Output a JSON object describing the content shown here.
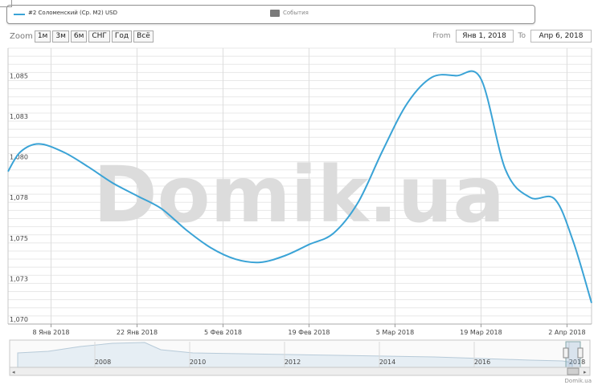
{
  "legend": {
    "series_label": "#2 Соломенский (Ср. М2) USD",
    "events_label": "События"
  },
  "toolbar": {
    "zoom_label": "Zoom",
    "buttons": [
      "1м",
      "3м",
      "6м",
      "СНГ",
      "Год",
      "Всё"
    ],
    "from_label": "From",
    "from_value": "Янв 1, 2018",
    "to_label": "To",
    "to_value": "Апр 6, 2018"
  },
  "watermark": "Domik.ua",
  "credit": "Domik.ua",
  "colors": {
    "series": "#3aa3d6",
    "grid": "#e8e8e8",
    "events": "#7a7a7a"
  },
  "chart_data": {
    "type": "line",
    "x_axis_type": "date",
    "xlim": [
      "2018-01-01",
      "2018-04-06"
    ],
    "ylim": [
      1.07,
      1.087
    ],
    "y_ticks": [
      1.07,
      1.0725,
      1.075,
      1.0775,
      1.08,
      1.0825,
      1.085
    ],
    "y_tick_labels": [
      "1,070",
      "1,073",
      "1,075",
      "1,078",
      "1,080",
      "1,083",
      "1,085"
    ],
    "x_ticks": [
      "2018-01-08",
      "2018-01-22",
      "2018-02-05",
      "2018-02-19",
      "2018-03-05",
      "2018-03-19",
      "2018-04-02"
    ],
    "x_tick_labels": [
      "8 Янв 2018",
      "22 Янв 2018",
      "5 Фев 2018",
      "19 Фев 2018",
      "5 Мар 2018",
      "19 Мар 2018",
      "2 Апр 2018"
    ],
    "grid": true,
    "legend_position": "top",
    "series": [
      {
        "name": "#2 Соломенский (Ср. М2) USD",
        "x": [
          "2018-01-01",
          "2018-01-03",
          "2018-01-06",
          "2018-01-10",
          "2018-01-14",
          "2018-01-18",
          "2018-01-22",
          "2018-01-26",
          "2018-01-30",
          "2018-02-03",
          "2018-02-07",
          "2018-02-11",
          "2018-02-15",
          "2018-02-19",
          "2018-02-23",
          "2018-02-27",
          "2018-03-03",
          "2018-03-07",
          "2018-03-11",
          "2018-03-15",
          "2018-03-19",
          "2018-03-23",
          "2018-03-27",
          "2018-03-31",
          "2018-04-03",
          "2018-04-06"
        ],
        "y": [
          1.0794,
          1.0806,
          1.0811,
          1.0806,
          1.0797,
          1.0787,
          1.0779,
          1.0771,
          1.0758,
          1.0747,
          1.074,
          1.0738,
          1.0742,
          1.0749,
          1.0756,
          1.0775,
          1.0807,
          1.0836,
          1.0852,
          1.0853,
          1.0851,
          1.0795,
          1.0778,
          1.0777,
          1.0751,
          1.0713
        ]
      }
    ],
    "navigator": {
      "year_labels": [
        "2008",
        "2010",
        "2012",
        "2014",
        "2016",
        "2018"
      ]
    }
  }
}
